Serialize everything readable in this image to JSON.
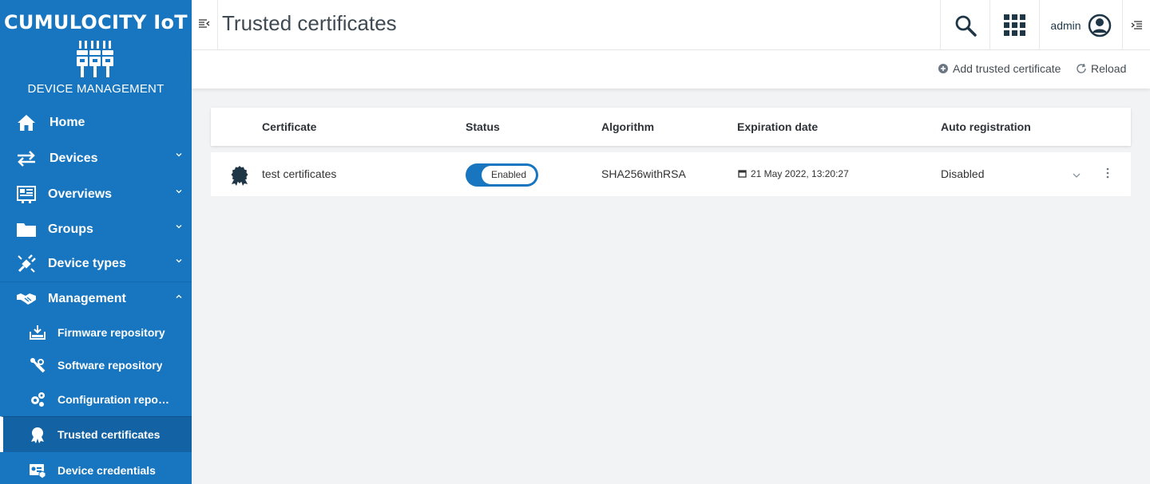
{
  "brand": {
    "name": "CUMULOCITY IoT",
    "subtitle": "DEVICE MANAGEMENT"
  },
  "sidebar": {
    "items": [
      {
        "label": "Home",
        "icon": "home-icon"
      },
      {
        "label": "Devices",
        "icon": "arrows-exchange-icon"
      },
      {
        "label": "Overviews",
        "icon": "dashboard-icon"
      },
      {
        "label": "Groups",
        "icon": "folder-icon"
      },
      {
        "label": "Device types",
        "icon": "plug-icon"
      },
      {
        "label": "Management",
        "icon": "handshake-icon"
      }
    ],
    "subitems": [
      {
        "label": "Firmware repository",
        "icon": "firmware-icon"
      },
      {
        "label": "Software repository",
        "icon": "wrench-icon"
      },
      {
        "label": "Configuration repository",
        "icon": "gears-icon"
      },
      {
        "label": "Trusted certificates",
        "icon": "certificate-icon"
      },
      {
        "label": "Device credentials",
        "icon": "id-card-icon"
      }
    ]
  },
  "header": {
    "title": "Trusted certificates",
    "user": "admin"
  },
  "actions": {
    "add": "Add trusted certificate",
    "reload": "Reload"
  },
  "table": {
    "columns": [
      "Certificate",
      "Status",
      "Algorithm",
      "Expiration date",
      "Auto registration"
    ],
    "rows": [
      {
        "certificate": "test certificates",
        "status": "Enabled",
        "algorithm": "SHA256withRSA",
        "expiration": "21 May 2022, 13:20:27",
        "auto_registration": "Disabled"
      }
    ]
  },
  "colors": {
    "sidebar": "#1776bf",
    "accent": "#1776bf",
    "active_item": "#1363a4"
  }
}
